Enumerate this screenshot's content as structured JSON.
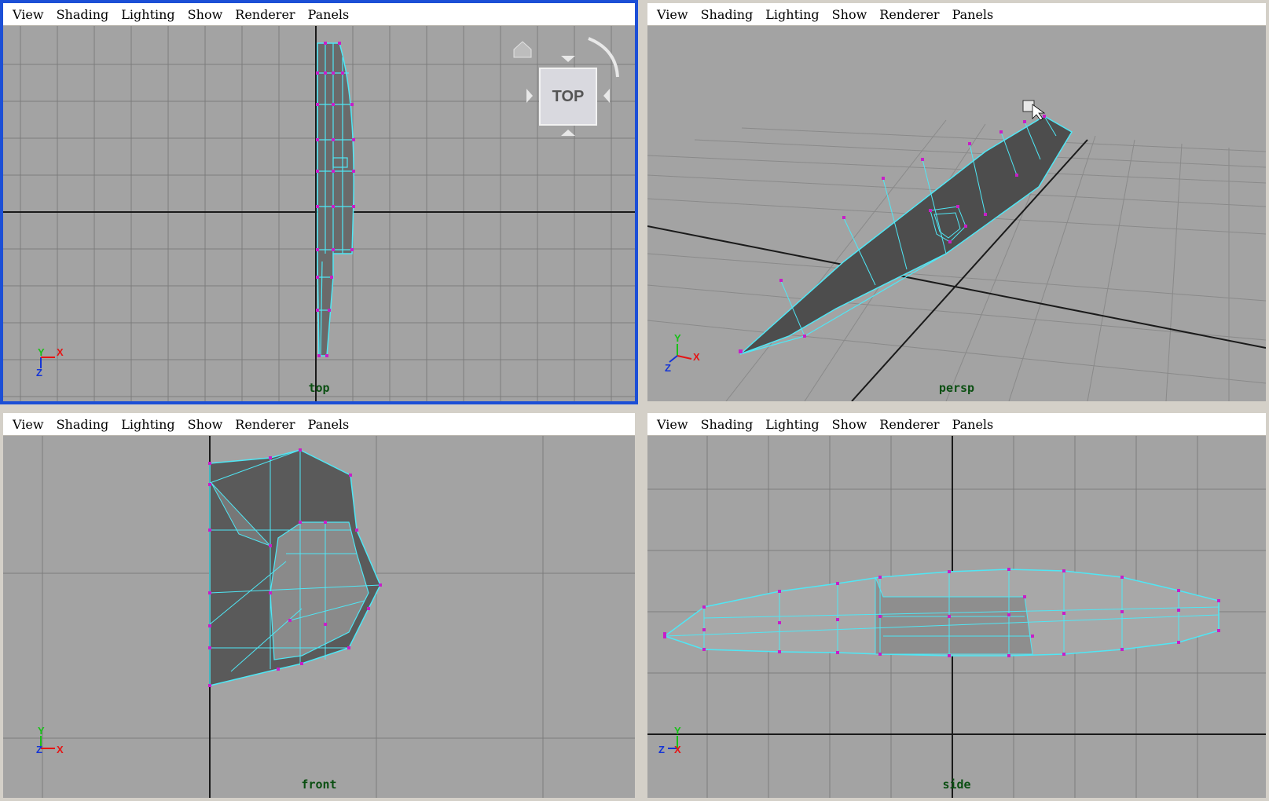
{
  "menu": [
    "View",
    "Shading",
    "Lighting",
    "Show",
    "Renderer",
    "Panels"
  ],
  "panels": {
    "top": {
      "camera": "top",
      "active": true
    },
    "persp": {
      "camera": "persp",
      "active": false
    },
    "front": {
      "camera": "front",
      "active": false
    },
    "side": {
      "camera": "side",
      "active": false
    }
  },
  "viewcube": {
    "face_label": "TOP"
  },
  "axes": {
    "x": "X",
    "y": "Y",
    "z": "Z"
  },
  "colors": {
    "viewport_bg": "#a3a3a3",
    "grid": "#7c7c7c",
    "origin_axis": "#1a1a1a",
    "wire": "#4fe7f5",
    "vertex": "#c81ec8",
    "mesh_fill": "#5b5b5b",
    "active_border": "#1c4fd6",
    "camera_label": "#0b4f12",
    "axis_x": "#e61414",
    "axis_y": "#18c018",
    "axis_z": "#1434d6"
  }
}
